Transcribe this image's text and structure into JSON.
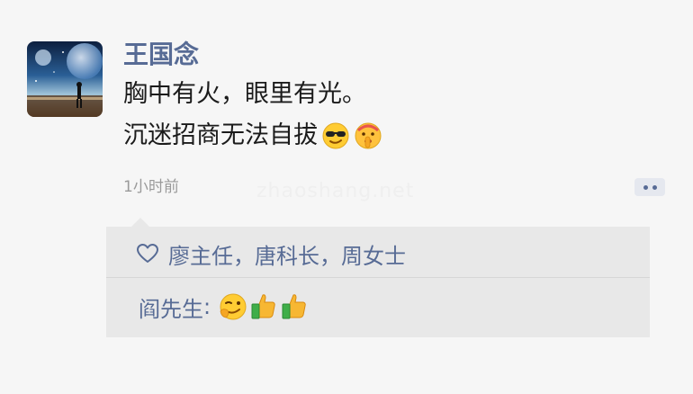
{
  "post": {
    "author": "王国念",
    "lines": [
      "胸中有火，眼里有光。",
      "沉迷招商无法自拔"
    ],
    "emojis": [
      "sunglasses-emoji",
      "shushing-face-emoji"
    ],
    "timestamp": "1小时前",
    "watermark": "zhaoshang.net",
    "avatar": "astronaut-under-planets-avatar"
  },
  "likes": {
    "icon": "heart-outline-icon",
    "names": "廖主任，唐科长，周女士"
  },
  "comments": [
    {
      "author": "阎先生",
      "separator": ": ",
      "emojis": [
        "smirking-wink-emoji",
        "thumbs-up-emoji",
        "thumbs-up-emoji"
      ]
    }
  ],
  "colors": {
    "name_blue": "#576b95",
    "text": "#1b1b1b",
    "muted": "#9a9a9a",
    "background": "#f6f6f6",
    "comment_bg": "#e8e8e8"
  }
}
